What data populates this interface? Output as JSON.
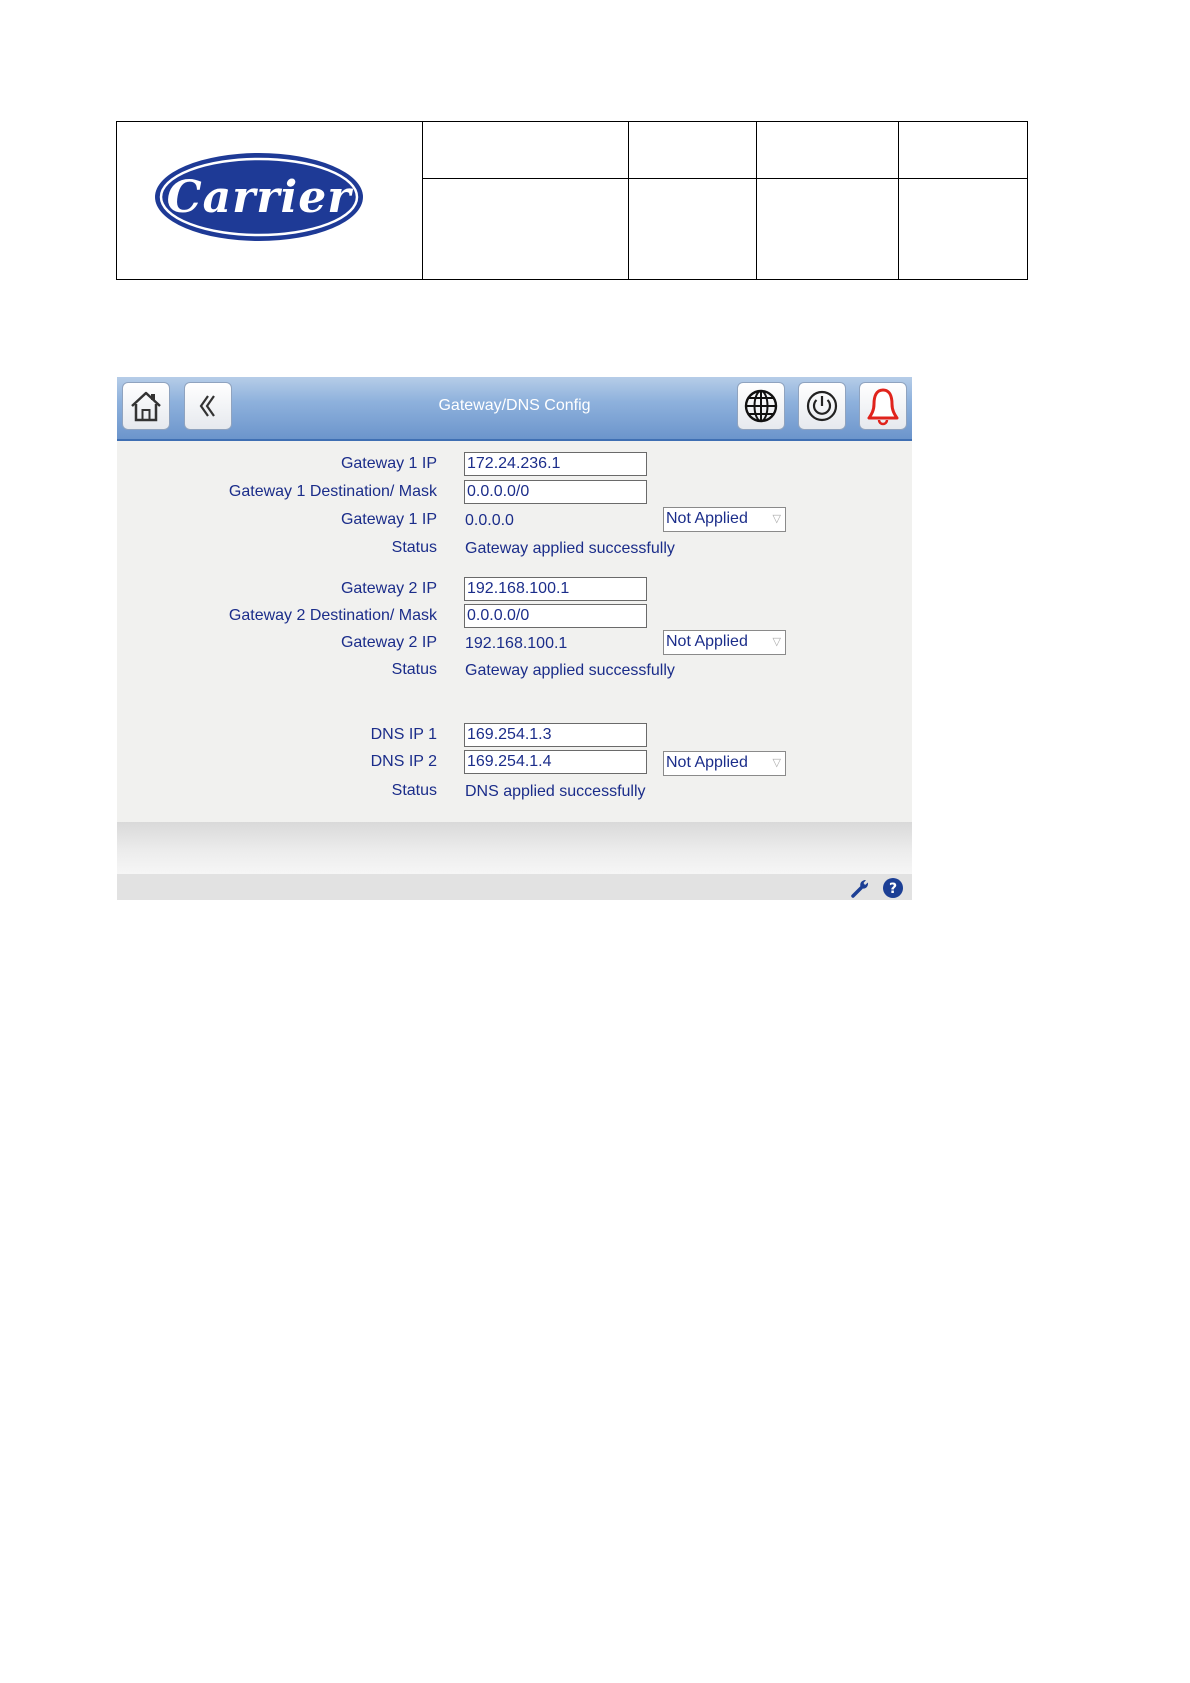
{
  "document": {
    "logo": {
      "text": "Carrier",
      "color": "#1e3a96",
      "icon": "carrier-logo"
    }
  },
  "screen": {
    "title": "Gateway/DNS Config",
    "toolbar": {
      "home_icon": "home-icon",
      "back_icon": "double-chevron-left-icon",
      "network_icon": "globe-icon",
      "power_icon": "power-icon",
      "alarm_icon": "bell-icon",
      "alarm_color": "#e0231c"
    },
    "gateway1": {
      "ip_label": "Gateway 1 IP",
      "ip_value": "172.24.236.1",
      "mask_label": "Gateway 1 Destination/ Mask",
      "mask_value": "0.0.0.0/0",
      "applied_label": "Gateway 1 IP",
      "applied_value": "0.0.0.0",
      "select_value": "Not Applied",
      "status_label": "Status",
      "status_value": "Gateway applied successfully"
    },
    "gateway2": {
      "ip_label": "Gateway 2 IP",
      "ip_value": "192.168.100.1",
      "mask_label": "Gateway 2 Destination/ Mask",
      "mask_value": "0.0.0.0/0",
      "applied_label": "Gateway 2 IP",
      "applied_value": "192.168.100.1",
      "select_value": "Not Applied",
      "status_label": "Status",
      "status_value": "Gateway applied successfully"
    },
    "dns": {
      "ip1_label": "DNS IP 1",
      "ip1_value": "169.254.1.3",
      "ip2_label": "DNS IP 2",
      "ip2_value": "169.254.1.4",
      "select_value": "Not Applied",
      "status_label": "Status",
      "status_value": "DNS applied successfully"
    },
    "bottom_bar": {
      "tools_icon": "wrench-icon",
      "help_icon": "help-icon",
      "help_color": "#1c3f95"
    },
    "colors": {
      "text": "#1b2d8a",
      "titlebar": "#7a9fd2",
      "background": "#f1f1ef"
    }
  }
}
